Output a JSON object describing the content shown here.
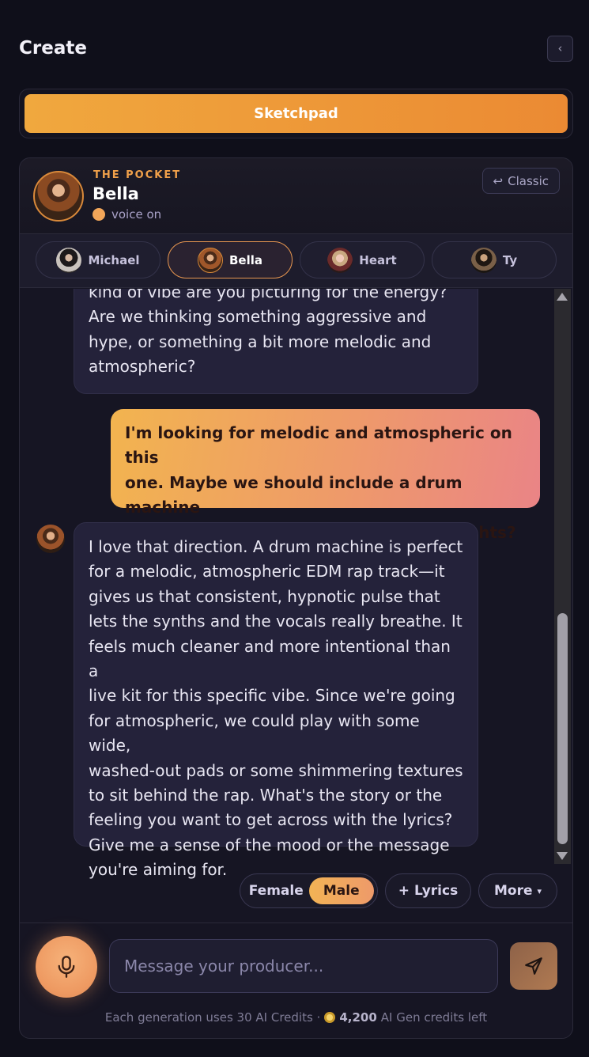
{
  "header": {
    "title": "Create",
    "collapse_icon": "‹"
  },
  "sketchpad": {
    "label": "Sketchpad"
  },
  "producer": {
    "eyebrow": "THE POCKET",
    "name": "Bella",
    "voice_status": "voice on",
    "classic_label": "Classic",
    "classic_icon": "↩"
  },
  "tabs": [
    {
      "label": "Michael",
      "active": false
    },
    {
      "label": "Bella",
      "active": true
    },
    {
      "label": "Heart",
      "active": false
    },
    {
      "label": "Ty",
      "active": false
    }
  ],
  "messages": [
    {
      "role": "assistant",
      "text": "kind of vibe are you picturing for the energy?\nAre we thinking something aggressive and\nhype, or something a bit more melodic and\natmospheric?"
    },
    {
      "role": "user",
      "text": "I'm looking for melodic and atmospheric on this\none. Maybe we should include a drum machine\ninstead of a traditional drum kit. Thoughts?"
    },
    {
      "role": "assistant",
      "text": "I love that direction. A drum machine is perfect\nfor a melodic, atmospheric EDM rap track—it\ngives us that consistent, hypnotic pulse that\nlets the synths and the vocals really breathe. It\nfeels much cleaner and more intentional than a\nlive kit for this specific vibe. Since we're going\nfor atmospheric, we could play with some wide,\nwashed-out pads or some shimmering textures\nto sit behind the rap. What's the story or the\nfeeling you want to get across with the lyrics?\nGive me a sense of the mood or the message\nyou're aiming for."
    }
  ],
  "controls": {
    "voice_options": [
      "Female",
      "Male"
    ],
    "selected_voice": "Male",
    "lyrics_label": "Lyrics",
    "lyrics_icon": "+",
    "more_label": "More",
    "more_icon": "▾"
  },
  "composer": {
    "placeholder": "Message your producer...",
    "value": "",
    "credits_prefix": "Each generation uses 30 AI Credits ·",
    "credits_count": "4,200",
    "credits_suffix": "AI Gen credits left"
  },
  "colors": {
    "accent": "#eb8a33",
    "accent_light": "#f0a83e",
    "background": "#0f0f1a",
    "panel": "#161523",
    "bubble_ai": "#24223a"
  },
  "icons": {
    "mic": "microphone-icon",
    "send": "send-icon",
    "coin": "coin-icon"
  }
}
